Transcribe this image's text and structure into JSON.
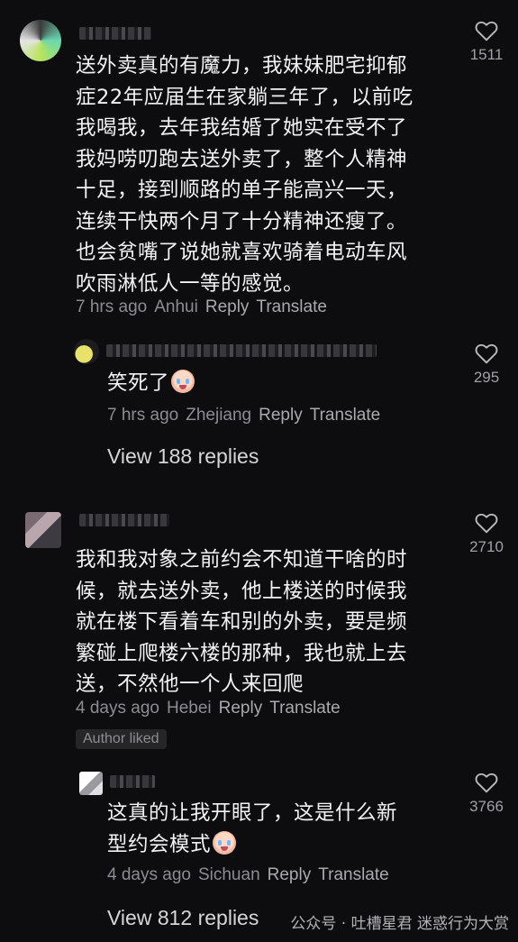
{
  "comments": [
    {
      "text": "送外卖真的有魔力，我妹妹肥宅抑郁\n症22年应届生在家躺三年了，以前吃\n我喝我，去年我结婚了她实在受不了\n我妈唠叨跑去送外卖了，整个人精神\n十足，接到顺路的单子能高兴一天，\n连续干快两个月了十分精神还瘦了。\n也会贫嘴了说她就喜欢骑着电动车风\n吹雨淋低人一等的感觉。",
      "time": "7 hrs ago",
      "location": "Anhui",
      "reply_label": "Reply",
      "translate_label": "Translate",
      "likes": "1511",
      "reply": {
        "text": "笑死了",
        "time": "7 hrs ago",
        "location": "Zhejiang",
        "reply_label": "Reply",
        "translate_label": "Translate",
        "likes": "295"
      },
      "view_replies": "View 188 replies"
    },
    {
      "text": "我和我对象之前约会不知道干啥的时\n候，就去送外卖，他上楼送的时候我\n就在楼下看着车和别的外卖，要是频\n繁碰上爬楼六楼的那种，我也就上去\n送，不然他一个人来回爬",
      "time": "4 days ago",
      "location": "Hebei",
      "reply_label": "Reply",
      "translate_label": "Translate",
      "likes": "2710",
      "author_badge": "Author liked",
      "reply": {
        "text": "这真的让我开眼了，这是什么新\n型约会模式",
        "time": "4 days ago",
        "location": "Sichuan",
        "reply_label": "Reply",
        "translate_label": "Translate",
        "likes": "3766"
      },
      "view_replies": "View 812 replies"
    }
  ],
  "watermark": "公众号 · 吐槽星君  迷惑行为大赏",
  "icons": {
    "like": "heart-outline-icon",
    "emoji": "crying-laughing-emoji-icon"
  },
  "colors": {
    "background": "#0d0d0f",
    "text": "#f2f2f4",
    "meta": "#8c8c92"
  }
}
